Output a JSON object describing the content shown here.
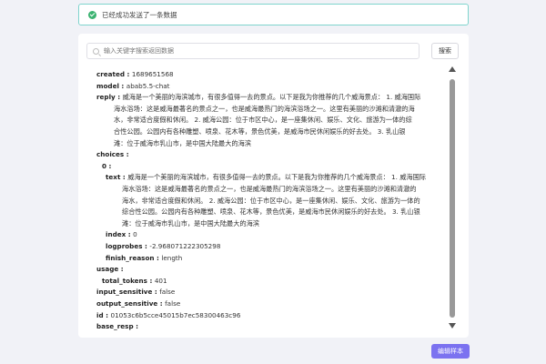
{
  "toast": {
    "message": "已经成功发送了一条数据"
  },
  "search": {
    "placeholder": "输入关键字搜索返回数据",
    "button_label": "搜索"
  },
  "response": {
    "created_key": "created : ",
    "created": "1689651568",
    "model_key": "model : ",
    "model": "abab5.5-chat",
    "reply_key": "reply : ",
    "reply_line1": "威海是一个美丽的海滨城市，有很多值得一去的景点。以下是我为你推荐的几个威海景点： 1. 威海国际",
    "reply_line2": "海水浴场：这是威海最著名的景点之一，也是威海最热门的海滨浴场之一。这里有美丽的沙滩和清澈的海",
    "reply_line3": "水，非常适合度假和休闲。 2. 威海公园：位于市区中心，是一座集休闲、娱乐、文化、旅游为一体的综",
    "reply_line4": "合性公园。公园内有各种雕塑、喷泉、花木等，景色优美，是威海市民休闲娱乐的好去处。 3. 乳山银",
    "reply_line5": "滩：位于威海市乳山市，是中国大陆最大的海滨",
    "choices_key": "choices :",
    "choice_index_key": "0 :",
    "text_key": "text : ",
    "text_line1": "威海是一个美丽的海滨城市，有很多值得一去的景点。以下是我为你推荐的几个威海景点： 1. 威海国际",
    "text_line2": "海水浴场：这是威海最著名的景点之一，也是威海最热门的海滨浴场之一。这里有美丽的沙滩和清澈的",
    "text_line3": "海水，非常适合度假和休闲。 2. 威海公园：位于市区中心，是一座集休闲、娱乐、文化、旅游为一体的",
    "text_line4": "综合性公园。公园内有各种雕塑、喷泉、花木等，景色优美，是威海市民休闲娱乐的好去处。 3. 乳山银",
    "text_line5": "滩：位于威海市乳山市，是中国大陆最大的海滨",
    "index_key": "index : ",
    "index": "0",
    "logprobes_key": "logprobes : ",
    "logprobes": "-2.968071222305298",
    "finish_reason_key": "finish_reason : ",
    "finish_reason": "length",
    "usage_key": "usage :",
    "total_tokens_key": "total_tokens : ",
    "total_tokens": "401",
    "input_sensitive_key": "input_sensitive : ",
    "input_sensitive": "false",
    "output_sensitive_key": "output_sensitive : ",
    "output_sensitive": "false",
    "id_key": "id : ",
    "id": "01053c6b5cce45015b7ec58300463c96",
    "base_resp_key": "base_resp :"
  },
  "actions": {
    "edit_sample_label": "编辑样本"
  },
  "colors": {
    "accent": "#7b72f0",
    "success": "#3cb371",
    "toast_border": "#7fd4cd"
  }
}
